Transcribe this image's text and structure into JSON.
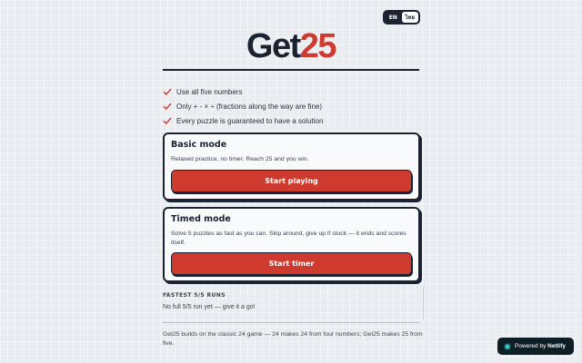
{
  "language_toggle": {
    "options": [
      {
        "label": "EN",
        "active": true
      },
      {
        "label": "ไทย",
        "active": false
      }
    ]
  },
  "logo": {
    "part_a": "Get",
    "part_b": "25"
  },
  "rules": [
    {
      "text": "Use all five numbers",
      "icon": "check-icon"
    },
    {
      "text": "Only + - × ÷ (fractions along the way are fine)",
      "icon": "check-icon"
    },
    {
      "text": "Every puzzle is guaranteed to have a solution",
      "icon": "check-icon"
    }
  ],
  "modes": {
    "basic": {
      "title": "Basic mode",
      "description": "Relaxed practice, no timer. Reach 25 and you win.",
      "button_label": "Start playing"
    },
    "timed": {
      "title": "Timed mode",
      "description": "Solve 5 puzzles as fast as you can. Skip around, give up if stuck — it ends and scores itself.",
      "button_label": "Start timer"
    }
  },
  "fastest_runs": {
    "heading": "FASTEST 5/5 RUNS",
    "empty_text": "No full 5/5 run yet — give it a go!"
  },
  "footer": {
    "note": "Get25 builds on the classic 24 game — 24 makes 24 from four numbers; Get25 makes 25 from five."
  },
  "netlify_badge": {
    "prefix": "Powered by",
    "brand": "Netlify",
    "icon": "netlify-icon"
  },
  "colors": {
    "accent_red": "#cf3a2e",
    "ink": "#1b2330",
    "background": "#e9edf1",
    "check_red": "#cf3a2e",
    "netlify_teal": "#32e6e2"
  }
}
